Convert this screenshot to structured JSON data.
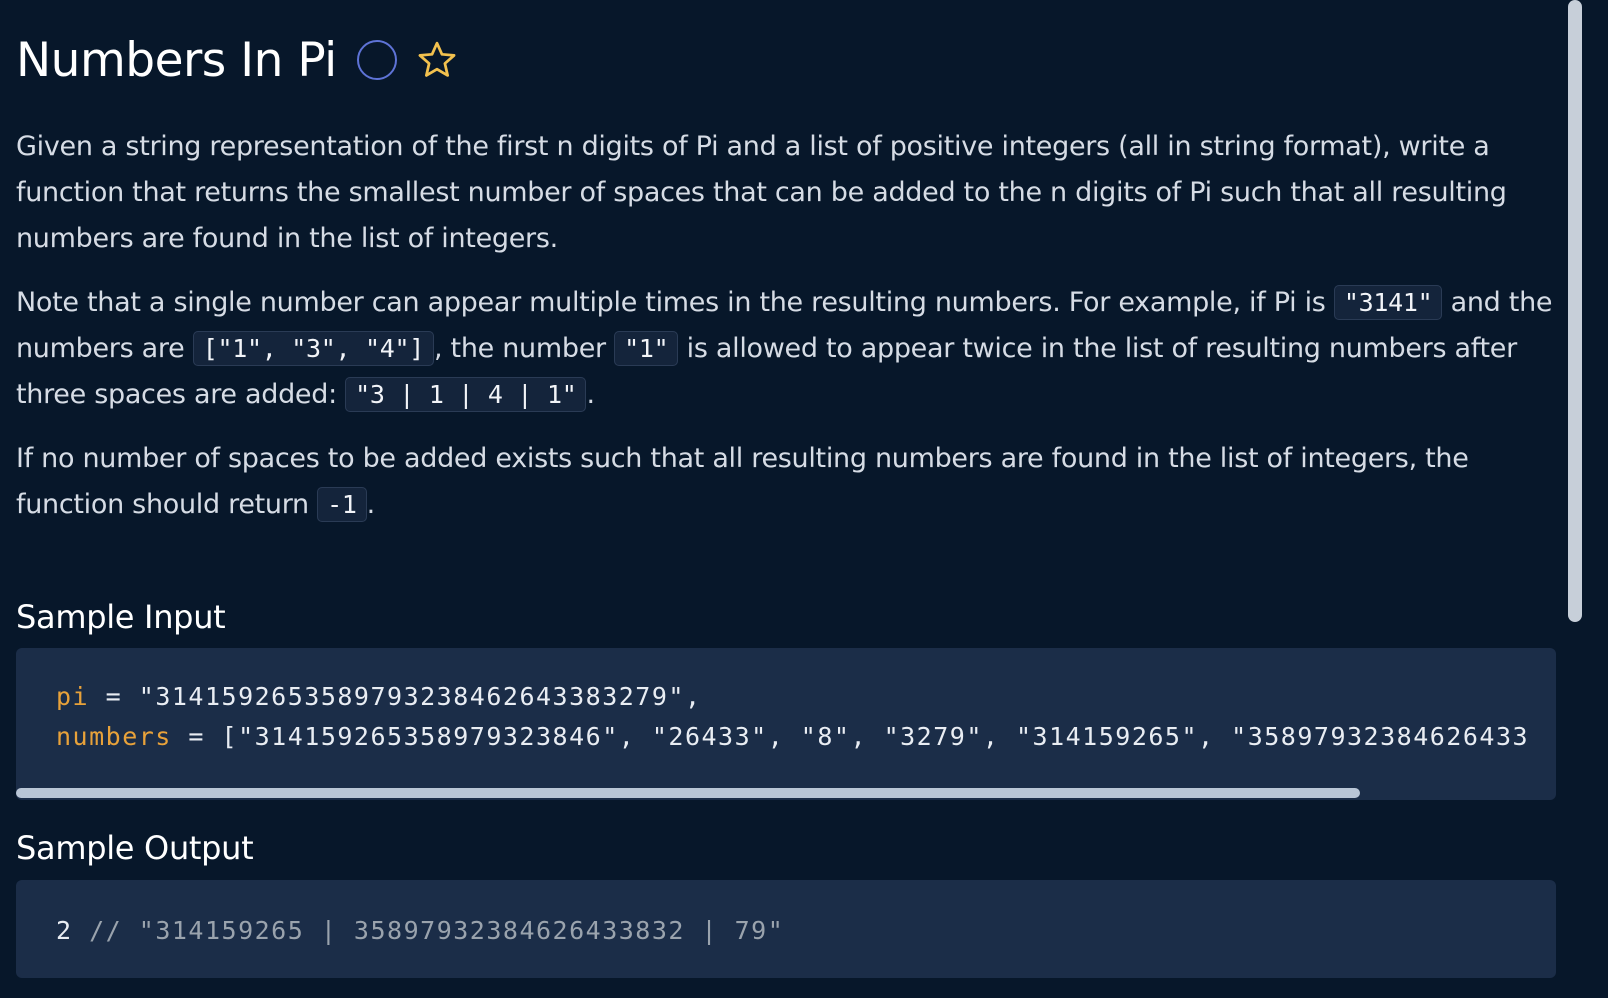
{
  "title": "Numbers In Pi",
  "paragraphs": {
    "p1": "Given a string representation of the first n digits of Pi and a list of positive integers (all in string format), write a function that returns the smallest number of spaces that can be added to the n digits of Pi such that all resulting numbers are found in the list of integers.",
    "p2_a": "Note that a single number can appear multiple times in the resulting numbers. For example, if Pi is ",
    "p2_code1": "\"3141\"",
    "p2_b": " and the numbers are ",
    "p2_code2": "[\"1\", \"3\", \"4\"]",
    "p2_c": ", the number ",
    "p2_code3": "\"1\"",
    "p2_d": " is allowed to appear twice in the list of resulting numbers after three spaces are added: ",
    "p2_code4": "\"3 | 1 | 4 | 1\"",
    "p2_e": ".",
    "p3_a": "If no number of spaces to be added exists such that all resulting numbers are found in the list of integers, the function should return ",
    "p3_code": "-1",
    "p3_b": "."
  },
  "sample_input": {
    "heading": "Sample Input",
    "line1_key": "pi",
    "line1_rest": " = \"3141592653589793238462643383279\",",
    "line2_key": "numbers",
    "line2_rest": " = [\"314159265358979323846\", \"26433\", \"8\", \"3279\", \"314159265\", \"35897932384626433"
  },
  "sample_output": {
    "heading": "Sample Output",
    "value": "2",
    "comment": " // \"314159265 | 35897932384626433832 | 79\""
  },
  "colors": {
    "background": "#07172a",
    "code_block": "#1b2d48",
    "keyword": "#e8a23a",
    "status_circle": "#5e73d6",
    "star": "#f2c14e"
  },
  "icons": [
    "status-circle-icon",
    "star-icon"
  ]
}
